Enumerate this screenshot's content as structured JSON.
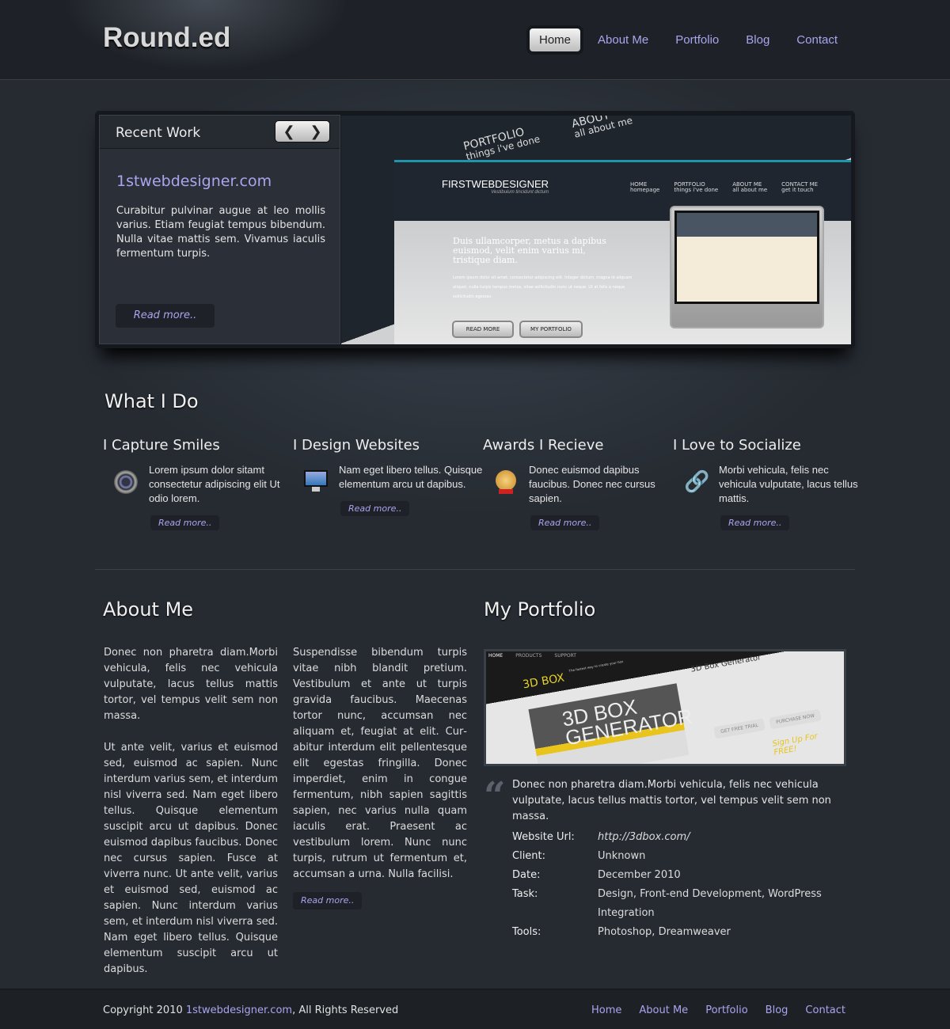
{
  "header": {
    "logo": "Round.ed",
    "nav": [
      "Home",
      "About Me",
      "Portfolio",
      "Blog",
      "Contact"
    ],
    "active": "Home"
  },
  "slider": {
    "title": "Recent Work",
    "prev_icon": "chevron-left-icon",
    "next_icon": "chevron-right-icon",
    "item_title": "1stwebdesigner.com",
    "item_text": "Curabitur pulvinar augue at leo mollis varius. Etiam feugiat tempus bibendum. Nulla vitae mattis sem. Vivamus iaculis fer­mentum turpis.",
    "read_more": "Read more..",
    "screenshot": {
      "brand": "FIRSTWEBDESIGNER",
      "tagline": "Vestibulum tincidunt dictum",
      "nav": [
        {
          "t": "HOME",
          "s": "homepage"
        },
        {
          "t": "PORTFOLIO",
          "s": "things i've done"
        },
        {
          "t": "ABOUT ME",
          "s": "all about me"
        },
        {
          "t": "CONTACT ME",
          "s": "get it touch"
        }
      ],
      "tilt1": "PORTFOLIO",
      "tilt1s": "things i've done",
      "tilt2": "ABOUT",
      "tilt2s": "all about me",
      "headline": "Duis ullamcorper, metus a dapibus euismod, velit enim varius mi, tristique diam.",
      "body": "Lorem ipsum dolor sit amet, consectetur adipiscing elit. Integer dictum, magna id aliquam aliquet, nulla turpis tempus metus, vitae sollicitudin nunc ut neque. Ut at felis a neque sollicitudin egestas.",
      "btn1": "READ MORE",
      "btn2": "MY PORTFOLIO"
    }
  },
  "what_i_do": {
    "title": "What I Do",
    "items": [
      {
        "title": "I Capture Smiles",
        "icon": "camera-icon",
        "text": "Lorem ipsum dolor sitamt consectetur adipiscing elit Ut odio lorem.",
        "link": "Read more.."
      },
      {
        "title": "I Design Websites",
        "icon": "monitor-icon",
        "text": "Nam eget libero tellus. Quisque elementum arcu ut dapibus.",
        "link": "Read more.."
      },
      {
        "title": "Awards I Recieve",
        "icon": "medal-icon",
        "text": "Donec euismod dapibus faucibus. Donec nec cursus sapien.",
        "link": "Read more.."
      },
      {
        "title": "I Love to Socialize",
        "icon": "chain-link-icon",
        "text": "Morbi vehicula, felis nec vehicula vulputate, lacus tellus mattis.",
        "link": "Read more.."
      }
    ]
  },
  "about": {
    "title": "About Me",
    "col1": [
      "Donec non pharetra diam.Morbi vehicula, felis nec vehicula vulpu­tate, lacus tellus mattis tortor, vel tempus velit sem non massa.",
      "Ut ante velit, varius et euismod sed, euismod ac sapien. Nunc interdum varius sem, et interdum nisl viverra sed. Nam eget libero tellus. Quisque elementum suscipit arcu ut dapibus. Donec euismod dapibus faucibus. Donec nec cursus sapien. Fusce at viverra nunc. Ut ante velit, varius et euismod sed, euismod ac sapien. Nunc interdum varius sem, et interdum nisl viverra sed. Nam eget libero tellus. Quisque elementum suscipit arcu ut dapibus."
    ],
    "col2": "Suspendisse bibendum turpis vitae nibh blandit pretium. Vestibulum et ante ut turpis gravida faucibus. Maecenas tortor nunc, accumsan nec aliquam et, feugiat at elit. Cur­abitur interdum elit pellentesque elit egestas fringilla. Donec imperdiet, enim in congue fermentum, nibh sapien sagittis sapien, nec varius nulla quam iaculis erat. Praesent ac vestibulum lorem. Nunc nunc turpis, rutrum ut fermentum et, accumsan a urna. Nulla facilisi.",
    "read_more": "Read more.."
  },
  "portfolio": {
    "title": "My Portfolio",
    "image": {
      "nav": [
        "HOME",
        "PRODUCTS",
        "SUPPORT"
      ],
      "logo": "3D BOX",
      "tagline": "The fastest way to create your box",
      "box": "3D BOX GENERATOR",
      "heading": "3D Box Generator",
      "btn1": "GET FREE TRIAL",
      "btn2": "PURCHASE NOW",
      "signup": "Sign Up For FREE!"
    },
    "quote": "Donec non pharetra diam.Morbi vehicula, felis nec vehicula vulputate, lacus tellus mattis tortor, vel tempus velit sem non massa.",
    "details": [
      {
        "k": "Website Url:",
        "v": "http://3dbox.com/"
      },
      {
        "k": "Client:",
        "v": "Unknown"
      },
      {
        "k": "Date:",
        "v": "December 2010"
      },
      {
        "k": "Task:",
        "v": "Design, Front-end Development, WordPress Integration"
      },
      {
        "k": "Tools:",
        "v": "Photoshop, Dreamweaver"
      }
    ]
  },
  "footer": {
    "copy_prefix": "Copyright 2010 ",
    "copy_link": "1stwebdesigner.com",
    "copy_suffix": ", All Rights Reserved",
    "nav": [
      "Home",
      "About Me",
      "Portfolio",
      "Blog",
      "Contact"
    ]
  },
  "colors": {
    "accent": "#a9a5ee",
    "background": "#262b32",
    "header": "#1e2228",
    "teal": "#1e95ab"
  }
}
